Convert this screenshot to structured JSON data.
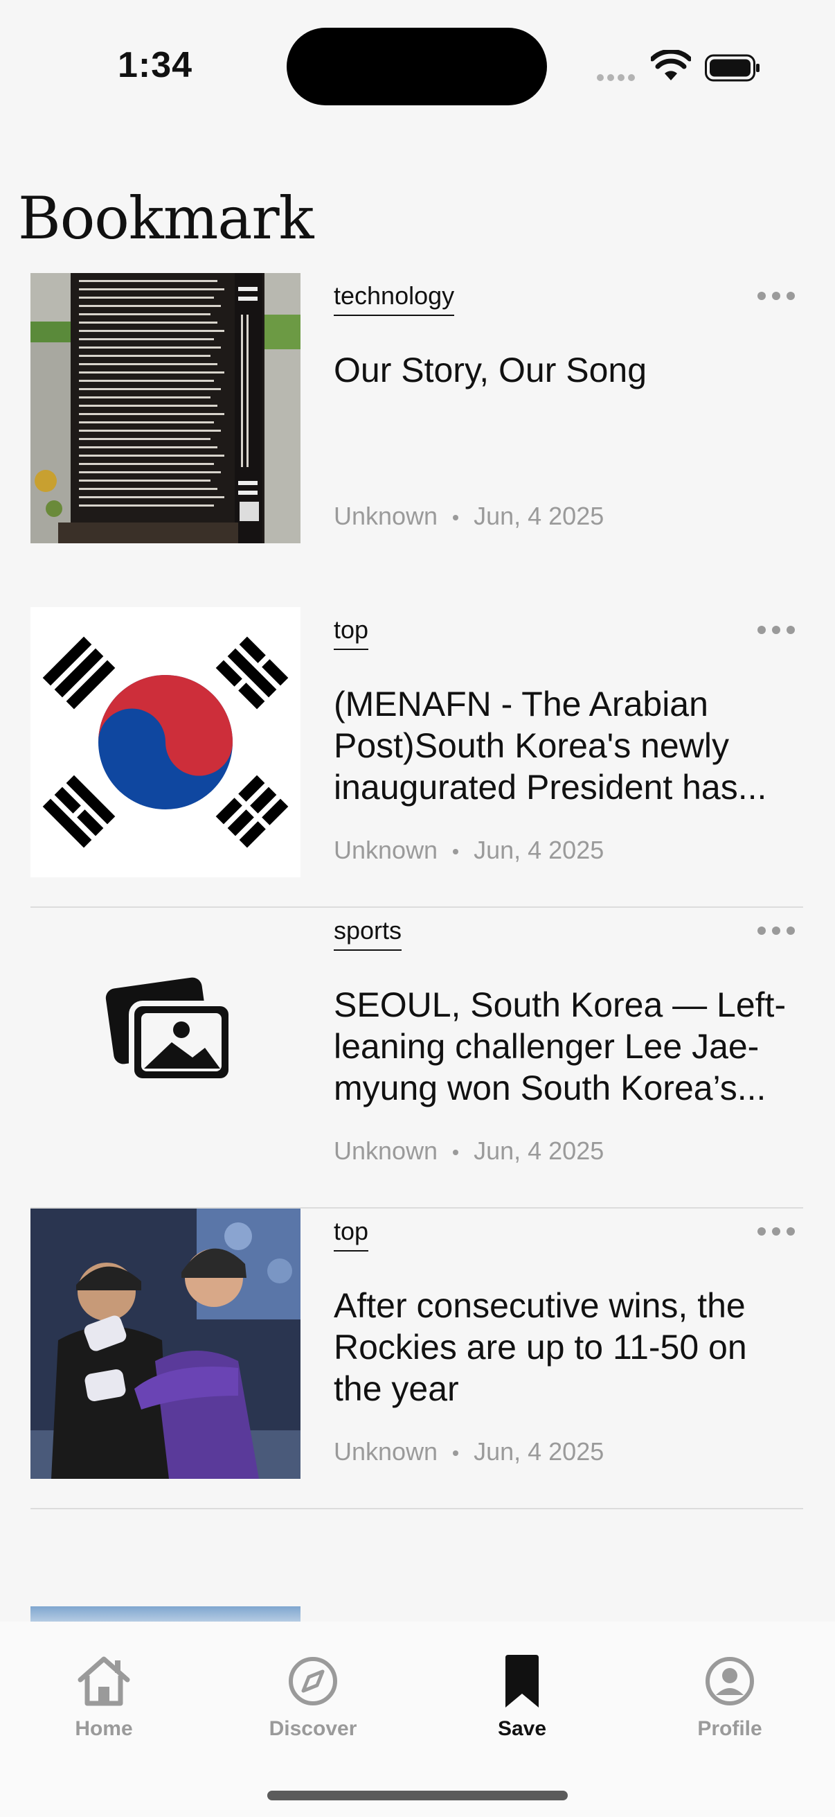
{
  "status_bar": {
    "time": "1:34"
  },
  "page": {
    "title": "Bookmark"
  },
  "articles": [
    {
      "category": "technology",
      "title": "Our Story, Our Song",
      "author": "Unknown",
      "date": "Jun, 4 2025",
      "thumbnail": "memorial-monument-photo"
    },
    {
      "category": "top",
      "title": "(MENAFN - The Arabian Post)South Korea's newly inaugurated President has...",
      "author": "Unknown",
      "date": "Jun, 4 2025",
      "thumbnail": "south-korea-flag"
    },
    {
      "category": "sports",
      "title": "SEOUL, South Korea — Left-leaning challenger Lee Jae-myung won South Korea’s...",
      "author": "Unknown",
      "date": "Jun, 4 2025",
      "thumbnail": "image-placeholder-icon"
    },
    {
      "category": "top",
      "title": "After consecutive wins, the Rockies are up to 11-50 on the year",
      "author": "Unknown",
      "date": "Jun, 4 2025",
      "thumbnail": "baseball-players-hug-photo"
    }
  ],
  "tabbar": {
    "items": [
      {
        "label": "Home",
        "icon": "home-icon",
        "active": false
      },
      {
        "label": "Discover",
        "icon": "compass-icon",
        "active": false
      },
      {
        "label": "Save",
        "icon": "bookmark-icon",
        "active": true
      },
      {
        "label": "Profile",
        "icon": "profile-icon",
        "active": false
      }
    ]
  },
  "colors": {
    "background": "#f6f6f6",
    "active_tab": "#111111",
    "inactive_tab": "#9a9a9a",
    "meta_text": "#9a9a9a"
  }
}
